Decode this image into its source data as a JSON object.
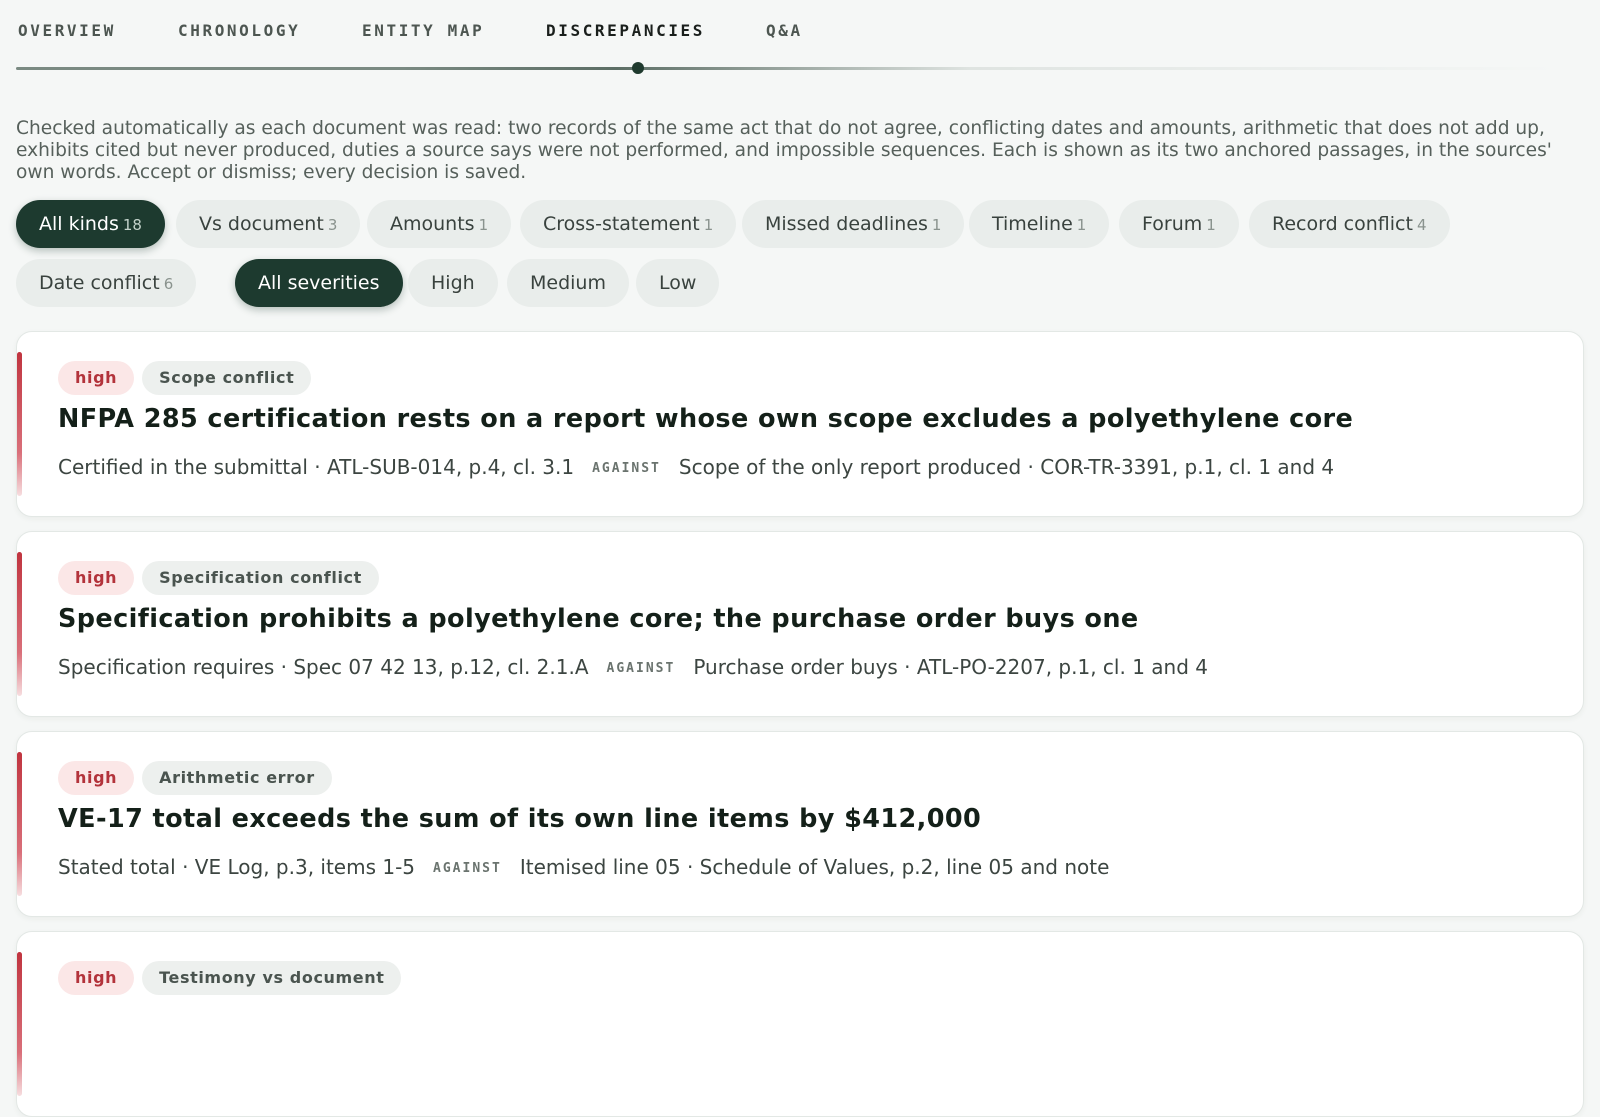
{
  "tabs": [
    {
      "label": "OVERVIEW",
      "active": false
    },
    {
      "label": "CHRONOLOGY",
      "active": false
    },
    {
      "label": "ENTITY MAP",
      "active": false
    },
    {
      "label": "DISCREPANCIES",
      "active": true
    },
    {
      "label": "Q&A",
      "active": false
    }
  ],
  "intro": "Checked automatically as each document was read: two records of the same act that do not agree, conflicting dates and amounts, arithmetic that does not add up, exhibits cited but never produced, duties a source says were not performed, and impossible sequences. Each is shown as its two anchored passages, in the sources' own words. Accept or dismiss; every decision is saved.",
  "kind_filters": [
    {
      "label": "All kinds",
      "count": "18",
      "active": true
    },
    {
      "label": "Vs document",
      "count": "3",
      "active": false
    },
    {
      "label": "Amounts",
      "count": "1",
      "active": false
    },
    {
      "label": "Cross-statement",
      "count": "1",
      "active": false
    },
    {
      "label": "Missed deadlines",
      "count": "1",
      "active": false
    },
    {
      "label": "Timeline",
      "count": "1",
      "active": false
    },
    {
      "label": "Forum",
      "count": "1",
      "active": false
    },
    {
      "label": "Record conflict",
      "count": "4",
      "active": false
    },
    {
      "label": "Date conflict",
      "count": "6",
      "active": false
    }
  ],
  "severity_filters": [
    {
      "label": "All severities",
      "active": true
    },
    {
      "label": "High",
      "active": false
    },
    {
      "label": "Medium",
      "active": false
    },
    {
      "label": "Low",
      "active": false
    }
  ],
  "against_label": "AGAINST",
  "cards": [
    {
      "severity": "high",
      "kind": "Scope conflict",
      "title": "NFPA 285 certification rests on a report whose own scope excludes a polyethylene core",
      "left": "Certified in the submittal · ATL-SUB-014, p.4, cl. 3.1",
      "right": "Scope of the only report produced · COR-TR-3391, p.1, cl. 1 and 4"
    },
    {
      "severity": "high",
      "kind": "Specification conflict",
      "title": "Specification prohibits a polyethylene core; the purchase order buys one",
      "left": "Specification requires · Spec 07 42 13, p.12, cl. 2.1.A",
      "right": "Purchase order buys · ATL-PO-2207, p.1, cl. 1 and 4"
    },
    {
      "severity": "high",
      "kind": "Arithmetic error",
      "title": "VE-17 total exceeds the sum of its own line items by $412,000",
      "left": "Stated total · VE Log, p.3, items 1-5",
      "right": "Itemised line 05 · Schedule of Values, p.2, line 05 and note"
    },
    {
      "severity": "high",
      "kind": "Testimony vs document",
      "title": "",
      "left": "",
      "right": ""
    }
  ]
}
